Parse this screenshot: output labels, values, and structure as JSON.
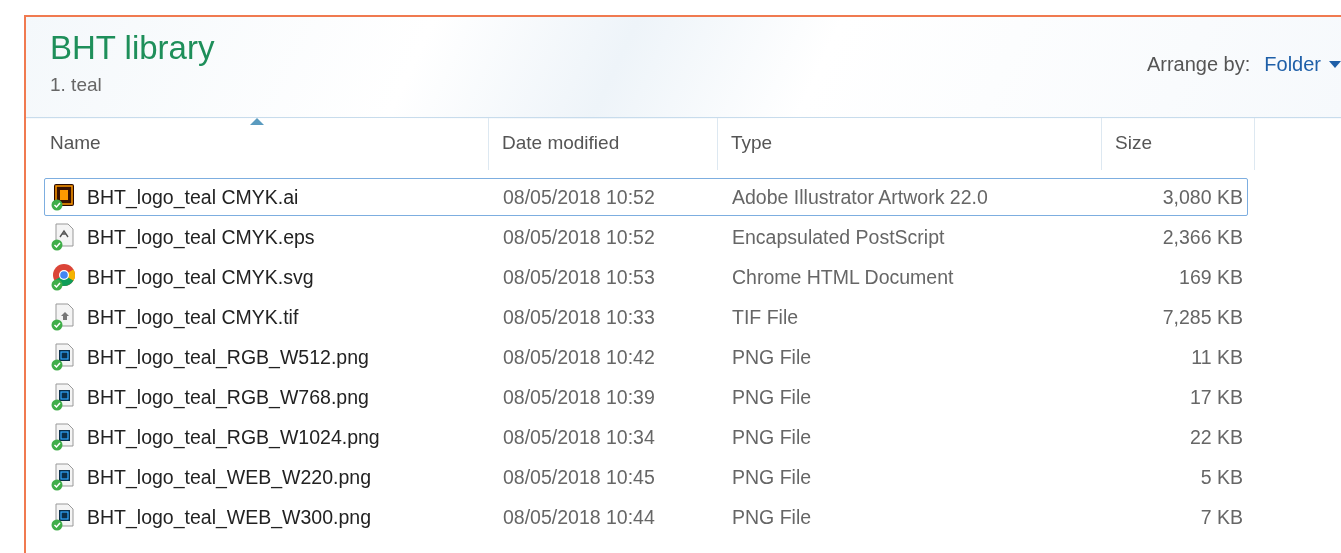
{
  "library": {
    "title": "BHT library",
    "subtitle": "1. teal",
    "arrange_label": "Arrange by:",
    "arrange_value": "Folder"
  },
  "columns": [
    {
      "label": "Name",
      "sorted": true
    },
    {
      "label": "Date modified",
      "sorted": false
    },
    {
      "label": "Type",
      "sorted": false
    },
    {
      "label": "Size",
      "sorted": false
    }
  ],
  "rows": [
    {
      "kind": "ai",
      "name": "BHT_logo_teal CMYK.ai",
      "date": "08/05/2018 10:52",
      "type": "Adobe Illustrator Artwork 22.0",
      "size": "3,080 KB",
      "focused": true,
      "synced": true
    },
    {
      "kind": "eps",
      "name": "BHT_logo_teal CMYK.eps",
      "date": "08/05/2018 10:52",
      "type": "Encapsulated PostScript",
      "size": "2,366 KB",
      "focused": false,
      "synced": true
    },
    {
      "kind": "chrome",
      "name": "BHT_logo_teal CMYK.svg",
      "date": "08/05/2018 10:53",
      "type": "Chrome HTML Document",
      "size": "169 KB",
      "focused": false,
      "synced": true
    },
    {
      "kind": "tif",
      "name": "BHT_logo_teal CMYK.tif",
      "date": "08/05/2018 10:33",
      "type": "TIF File",
      "size": "7,285 KB",
      "focused": false,
      "synced": true
    },
    {
      "kind": "png",
      "name": "BHT_logo_teal_RGB_W512.png",
      "date": "08/05/2018 10:42",
      "type": "PNG File",
      "size": "11 KB",
      "focused": false,
      "synced": true
    },
    {
      "kind": "png",
      "name": "BHT_logo_teal_RGB_W768.png",
      "date": "08/05/2018 10:39",
      "type": "PNG File",
      "size": "17 KB",
      "focused": false,
      "synced": true
    },
    {
      "kind": "png",
      "name": "BHT_logo_teal_RGB_W1024.png",
      "date": "08/05/2018 10:34",
      "type": "PNG File",
      "size": "22 KB",
      "focused": false,
      "synced": true
    },
    {
      "kind": "png",
      "name": "BHT_logo_teal_WEB_W220.png",
      "date": "08/05/2018 10:45",
      "type": "PNG File",
      "size": "5 KB",
      "focused": false,
      "synced": true
    },
    {
      "kind": "png",
      "name": "BHT_logo_teal_WEB_W300.png",
      "date": "08/05/2018 10:44",
      "type": "PNG File",
      "size": "7 KB",
      "focused": false,
      "synced": true
    }
  ]
}
